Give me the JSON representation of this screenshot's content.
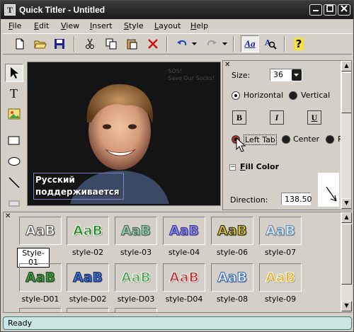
{
  "window": {
    "title": "Quick Titler - Untitled"
  },
  "menu": [
    "File",
    "Edit",
    "View",
    "Insert",
    "Style",
    "Layout",
    "Help"
  ],
  "menu_underline": [
    "F",
    "E",
    "V",
    "I",
    "S",
    "L",
    "H"
  ],
  "toolbar": {
    "icons": [
      "new-file-icon",
      "open-folder-icon",
      "save-icon",
      "cut-icon",
      "copy-icon",
      "paste-icon",
      "delete-icon",
      "undo-icon",
      "undo-dropdown-icon",
      "redo-icon",
      "redo-dropdown-icon",
      "text-style-icon",
      "text-search-icon",
      "help-icon"
    ],
    "text_style_label": "Aa",
    "help_label": "?"
  },
  "tools": [
    "select-arrow-icon",
    "text-tool-icon",
    "image-tool-icon",
    "rectangle-tool-icon",
    "ellipse-tool-icon",
    "line-tool-icon"
  ],
  "canvas": {
    "caption_line1": "Русский",
    "caption_line2": "поддерживается",
    "watermark_line1": "SOS!",
    "watermark_line2": "Save Our Socks!"
  },
  "properties": {
    "size_label": "Size:",
    "size_value": "36",
    "orientation": {
      "horizontal": "Horizontal",
      "vertical": "Vertical",
      "selected": "Horizontal"
    },
    "bold": "B",
    "italic": "I",
    "underline": "U",
    "tab": {
      "left": "Left Tab",
      "center": "Center",
      "right": "R",
      "selected": "Left Tab"
    },
    "fill_color_toggle": "−",
    "fill_color_label": "Fill Color",
    "direction_label": "Direction:",
    "direction_value": "138.50"
  },
  "gallery": {
    "tile_text": "AaB",
    "styles": [
      {
        "name": "Style-01",
        "fill": "#ffffff",
        "stroke": "#555555"
      },
      {
        "name": "style-02",
        "fill": "#1a8a1a",
        "stroke": "#ffffff"
      },
      {
        "name": "style-03",
        "fill": "#9ec4b0",
        "stroke": "#3a6a50"
      },
      {
        "name": "style-04",
        "fill": "#8a86f0",
        "stroke": "#30308a"
      },
      {
        "name": "style-06",
        "fill": "#d8c020",
        "stroke": "#1a1a1a"
      },
      {
        "name": "style-07",
        "fill": "#cfe4f4",
        "stroke": "#6a8aa8"
      },
      {
        "name": "style-D01",
        "fill": "#3e9a3e",
        "stroke": "#1a3a1a"
      },
      {
        "name": "style-D02",
        "fill": "#3a6ed8",
        "stroke": "#102050"
      },
      {
        "name": "style-D03",
        "fill": "#4aa84a",
        "stroke": "#ffffff"
      },
      {
        "name": "style-D04",
        "fill": "#c83030",
        "stroke": "#ffffff"
      },
      {
        "name": "style-08",
        "fill": "#e8f2ff",
        "stroke": "#2a60c0"
      },
      {
        "name": "style-09",
        "fill": "#f0b020",
        "stroke": "#ffffff"
      }
    ],
    "selected": "Style-01"
  },
  "status": {
    "text": "Ready"
  }
}
